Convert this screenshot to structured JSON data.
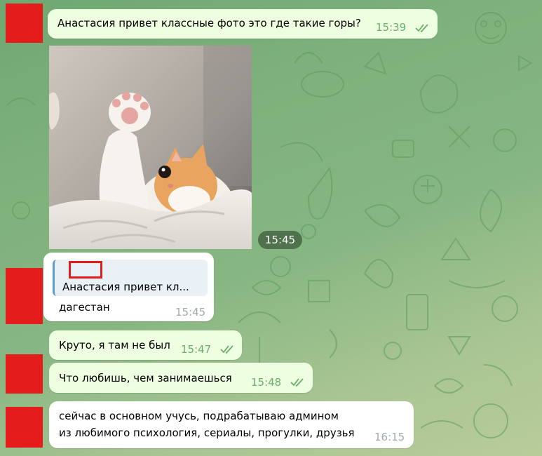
{
  "chat": {
    "messages": [
      {
        "type": "outgoing-text",
        "text": "Анастасия привет классные фото это где такие горы?",
        "time": "15:39",
        "read": true
      },
      {
        "type": "incoming-photo",
        "time": "15:45"
      },
      {
        "type": "incoming-reply",
        "reply_to": "Анастасия привет кл...",
        "text": "дагестан",
        "time": "15:45"
      },
      {
        "type": "outgoing-text",
        "text": "Круто, я там не был",
        "time": "15:47",
        "read": true
      },
      {
        "type": "outgoing-text",
        "text": "Что любишь, чем занимаешься",
        "time": "15:48",
        "read": true
      },
      {
        "type": "incoming-text",
        "lines": [
          "сейчас в основном учусь, подрабатываю админом",
          "из любимого психология, сериалы, прогулки, друзья"
        ],
        "time": "16:15"
      }
    ]
  },
  "colors": {
    "outgoing_bubble": "#eefee0",
    "incoming_bubble": "#ffffff",
    "read_check": "#6cae69",
    "redaction": "#e51c1c",
    "reply_bar": "#5aa0d2"
  }
}
